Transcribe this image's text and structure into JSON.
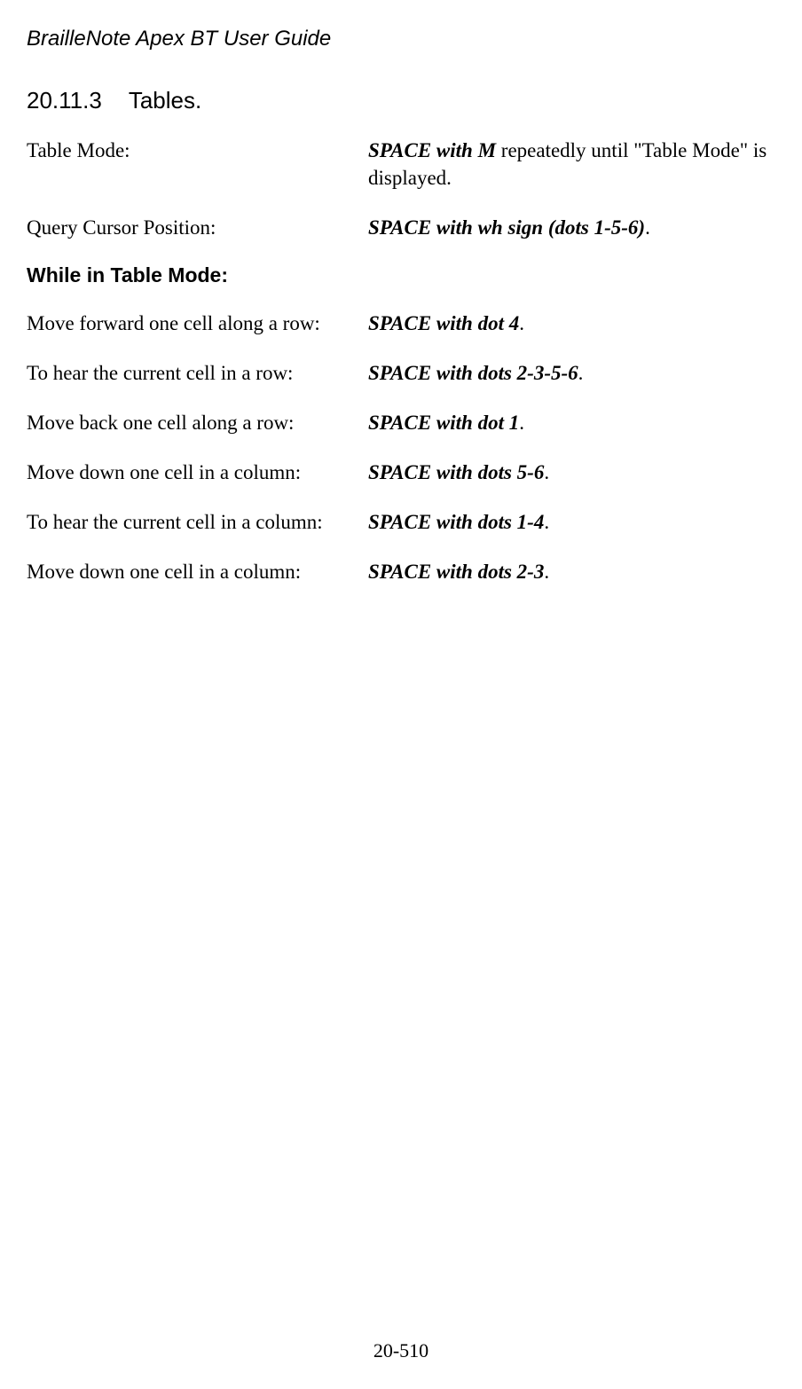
{
  "header": {
    "title": "BrailleNote Apex BT User Guide"
  },
  "section": {
    "number": "20.11.3",
    "title": "Tables."
  },
  "rows_top": [
    {
      "label": "Table Mode:",
      "bold": "SPACE with M",
      "tail": " repeatedly until \"Table Mode\" is displayed."
    },
    {
      "label": "Query Cursor Position:",
      "bold": "SPACE with wh sign (dots 1-5-6)",
      "tail": "."
    }
  ],
  "subheading": "While in Table Mode:",
  "rows_bottom": [
    {
      "label": "Move forward one cell along a row:",
      "bold": "SPACE with dot 4",
      "tail": "."
    },
    {
      "label": "To hear the current cell in a row:",
      "bold": "SPACE with dots 2-3-5-6",
      "tail": "."
    },
    {
      "label": "Move back one cell along a row:",
      "bold": "SPACE with dot 1",
      "tail": "."
    },
    {
      "label": "Move down one cell in a column:",
      "bold": "SPACE with dots 5-6",
      "tail": "."
    },
    {
      "label": "To hear the current cell in a column:",
      "bold": "SPACE with dots 1-4",
      "tail": "."
    },
    {
      "label": "Move down one cell in a column:",
      "bold": "SPACE with dots 2-3",
      "tail": "."
    }
  ],
  "footer": {
    "page": "20-510"
  }
}
